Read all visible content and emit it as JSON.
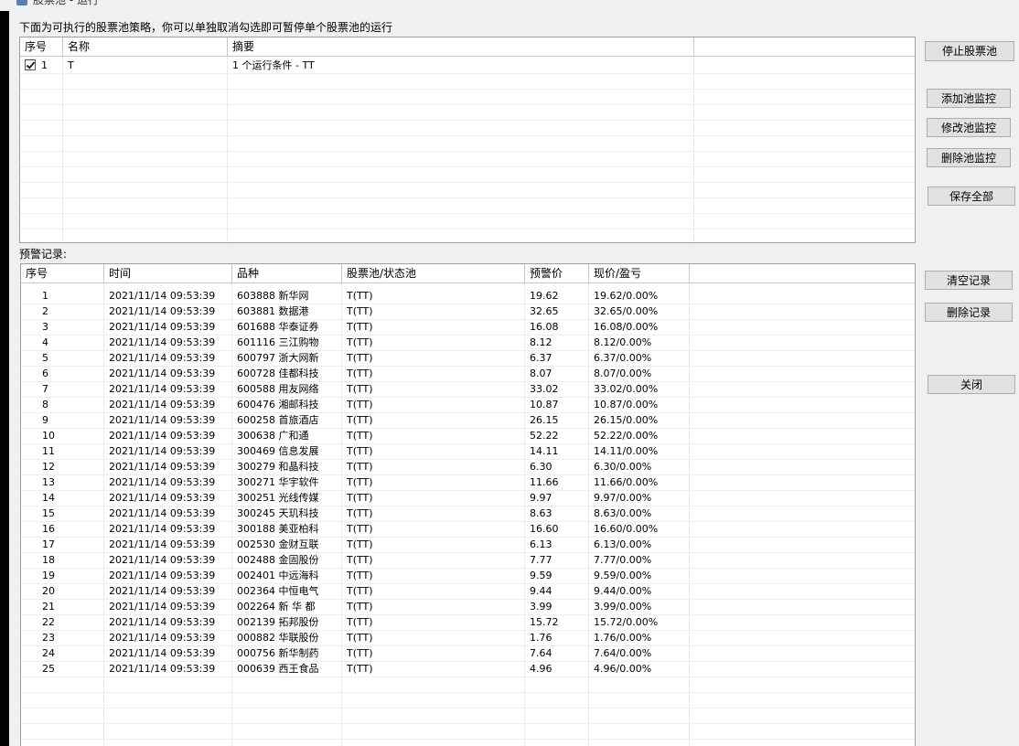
{
  "window": {
    "title": "股票池 - 运行"
  },
  "instruction": "下面为可执行的股票池策略，你可以单独取消勾选即可暂停单个股票池的运行",
  "pool_table": {
    "columns": [
      "序号",
      "名称",
      "摘要"
    ],
    "rows": [
      {
        "checked": true,
        "index": "1",
        "name": "T",
        "summary": "1 个运行条件 - TT"
      }
    ]
  },
  "pool_buttons": {
    "stop": "停止股票池",
    "add": "添加池监控",
    "edit": "修改池监控",
    "delete": "删除池监控",
    "save_all": "保存全部"
  },
  "alert_label": "预警记录:",
  "alert_table": {
    "columns": [
      "序号",
      "时间",
      "品种",
      "股票池/状态池",
      "预警价",
      "现价/盈亏"
    ],
    "rows": [
      [
        "1",
        "2021/11/14 09:53:39",
        "603888 新华网",
        "T(TT)",
        "19.62",
        "19.62/0.00%"
      ],
      [
        "2",
        "2021/11/14 09:53:39",
        "603881 数据港",
        "T(TT)",
        "32.65",
        "32.65/0.00%"
      ],
      [
        "3",
        "2021/11/14 09:53:39",
        "601688 华泰证券",
        "T(TT)",
        "16.08",
        "16.08/0.00%"
      ],
      [
        "4",
        "2021/11/14 09:53:39",
        "601116 三江购物",
        "T(TT)",
        "8.12",
        "8.12/0.00%"
      ],
      [
        "5",
        "2021/11/14 09:53:39",
        "600797 浙大网新",
        "T(TT)",
        "6.37",
        "6.37/0.00%"
      ],
      [
        "6",
        "2021/11/14 09:53:39",
        "600728 佳都科技",
        "T(TT)",
        "8.07",
        "8.07/0.00%"
      ],
      [
        "7",
        "2021/11/14 09:53:39",
        "600588 用友网络",
        "T(TT)",
        "33.02",
        "33.02/0.00%"
      ],
      [
        "8",
        "2021/11/14 09:53:39",
        "600476 湘邮科技",
        "T(TT)",
        "10.87",
        "10.87/0.00%"
      ],
      [
        "9",
        "2021/11/14 09:53:39",
        "600258 首旅酒店",
        "T(TT)",
        "26.15",
        "26.15/0.00%"
      ],
      [
        "10",
        "2021/11/14 09:53:39",
        "300638 广和通",
        "T(TT)",
        "52.22",
        "52.22/0.00%"
      ],
      [
        "11",
        "2021/11/14 09:53:39",
        "300469 信息发展",
        "T(TT)",
        "14.11",
        "14.11/0.00%"
      ],
      [
        "12",
        "2021/11/14 09:53:39",
        "300279 和晶科技",
        "T(TT)",
        "6.30",
        "6.30/0.00%"
      ],
      [
        "13",
        "2021/11/14 09:53:39",
        "300271 华宇软件",
        "T(TT)",
        "11.66",
        "11.66/0.00%"
      ],
      [
        "14",
        "2021/11/14 09:53:39",
        "300251 光线传媒",
        "T(TT)",
        "9.97",
        "9.97/0.00%"
      ],
      [
        "15",
        "2021/11/14 09:53:39",
        "300245 天玑科技",
        "T(TT)",
        "8.63",
        "8.63/0.00%"
      ],
      [
        "16",
        "2021/11/14 09:53:39",
        "300188 美亚柏科",
        "T(TT)",
        "16.60",
        "16.60/0.00%"
      ],
      [
        "17",
        "2021/11/14 09:53:39",
        "002530 金财互联",
        "T(TT)",
        "6.13",
        "6.13/0.00%"
      ],
      [
        "18",
        "2021/11/14 09:53:39",
        "002488 金固股份",
        "T(TT)",
        "7.77",
        "7.77/0.00%"
      ],
      [
        "19",
        "2021/11/14 09:53:39",
        "002401 中远海科",
        "T(TT)",
        "9.59",
        "9.59/0.00%"
      ],
      [
        "20",
        "2021/11/14 09:53:39",
        "002364 中恒电气",
        "T(TT)",
        "9.44",
        "9.44/0.00%"
      ],
      [
        "21",
        "2021/11/14 09:53:39",
        "002264 新 华 都",
        "T(TT)",
        "3.99",
        "3.99/0.00%"
      ],
      [
        "22",
        "2021/11/14 09:53:39",
        "002139 拓邦股份",
        "T(TT)",
        "15.72",
        "15.72/0.00%"
      ],
      [
        "23",
        "2021/11/14 09:53:39",
        "000882 华联股份",
        "T(TT)",
        "1.76",
        "1.76/0.00%"
      ],
      [
        "24",
        "2021/11/14 09:53:39",
        "000756 新华制药",
        "T(TT)",
        "7.64",
        "7.64/0.00%"
      ],
      [
        "25",
        "2021/11/14 09:53:39",
        "000639 西王食品",
        "T(TT)",
        "4.96",
        "4.96/0.00%"
      ]
    ]
  },
  "alert_buttons": {
    "clear": "清空记录",
    "delete": "删除记录",
    "close": "关闭"
  }
}
